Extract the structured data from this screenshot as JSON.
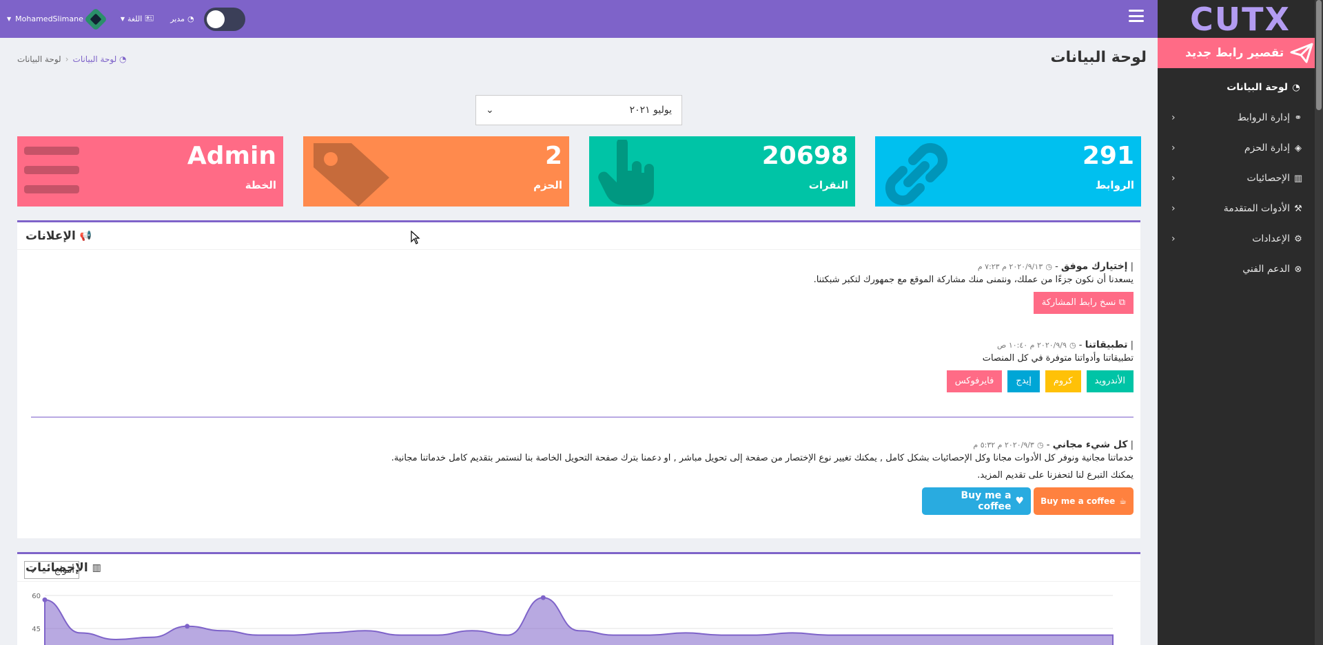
{
  "app": {
    "logo": "CUTX"
  },
  "sidebar": {
    "new_link_label": "تقصير رابط جديد",
    "items": [
      {
        "label": "لوحة البيانات",
        "icon": "gauge-icon"
      },
      {
        "label": "إدارة الروابط",
        "icon": "link-icon"
      },
      {
        "label": "إدارة الحزم",
        "icon": "tags-icon"
      },
      {
        "label": "الإحصائيات",
        "icon": "chart-icon"
      },
      {
        "label": "الأدوات المتقدمة",
        "icon": "wrench-icon"
      },
      {
        "label": "الإعدادات",
        "icon": "gear-icon"
      },
      {
        "label": "الدعم الفني",
        "icon": "lifebuoy-icon"
      }
    ]
  },
  "header": {
    "username": "MohamedSlimane",
    "language_label": "اللغة",
    "role_label": "مدير"
  },
  "page": {
    "title": "لوحة البيانات",
    "breadcrumb": {
      "link": "لوحة البيانات",
      "current": "لوحة البيانات"
    },
    "month_selected": "يوليو ٢٠٢١"
  },
  "stats": {
    "links": {
      "value": "291",
      "label": "الروابط"
    },
    "clicks": {
      "value": "20698",
      "label": "النقرات"
    },
    "packages": {
      "value": "2",
      "label": "الحزم"
    },
    "plan": {
      "value": "Admin",
      "label": "الخطة"
    }
  },
  "announcements": {
    "title": "الإعلانات",
    "items": [
      {
        "title": "إختيارك موفق",
        "meta": "٢٠٢٠/٩/١٣ م ٧:٢٣ م",
        "text": "يسعدنا أن نكون جزءًا من عملك، ونتمنى منك مشاركة الموقع مع جمهورك لتكبر شبكتنا.",
        "button": "نسخ رابط المشاركة"
      },
      {
        "title": "تطبيقاتنا",
        "meta": "٢٠٢٠/٩/٩ م ١٠:٤٠ ص",
        "text": "تطبيقاتنا وأدواتنا متوفرة في كل المنصات",
        "buttons": [
          "الأندرويد",
          "كروم",
          "إيدج",
          "فايرفوكس"
        ]
      },
      {
        "title": "كل شيء مجاني",
        "meta": "٢٠٢٠/٩/٣ م ٥:٣٢ م",
        "text": "خدماتنا مجانية ونوفر كل الأدوات مجانا وكل الإحصائيات بشكل كامل , يمكنك تغيير نوع الإختصار من صفحة إلى تحويل مباشر , او دعمنا بترك صفحة التحويل الخاصة بنا لنستمر بتقديم كامل خدماتنا مجانية.",
        "text2": "يمكنك التبرع لنا لتحفزنا على تقديم المزيد.",
        "coffee1": "Buy me a coffee",
        "coffee2": "Buy me a coffee"
      }
    ]
  },
  "statistics": {
    "title": "الإحصائيات",
    "chart_type_selected": "أمواج"
  },
  "chart_data": {
    "type": "area",
    "y_ticks": [
      "60",
      "45"
    ],
    "ylim": [
      45,
      60
    ],
    "values": [
      58,
      43,
      40,
      41,
      46,
      44,
      42,
      42,
      43,
      44,
      42,
      42,
      44,
      42,
      59,
      44,
      42,
      42,
      43,
      42,
      42,
      43,
      42,
      42,
      42,
      42,
      42,
      42,
      42,
      42,
      42
    ],
    "color": "#7e63c9"
  },
  "colors": {
    "accent": "#7e63c9",
    "links": "#00c0ef",
    "clicks": "#00c4a6",
    "packages": "#ff8a4d",
    "plan": "#ff6b86"
  }
}
